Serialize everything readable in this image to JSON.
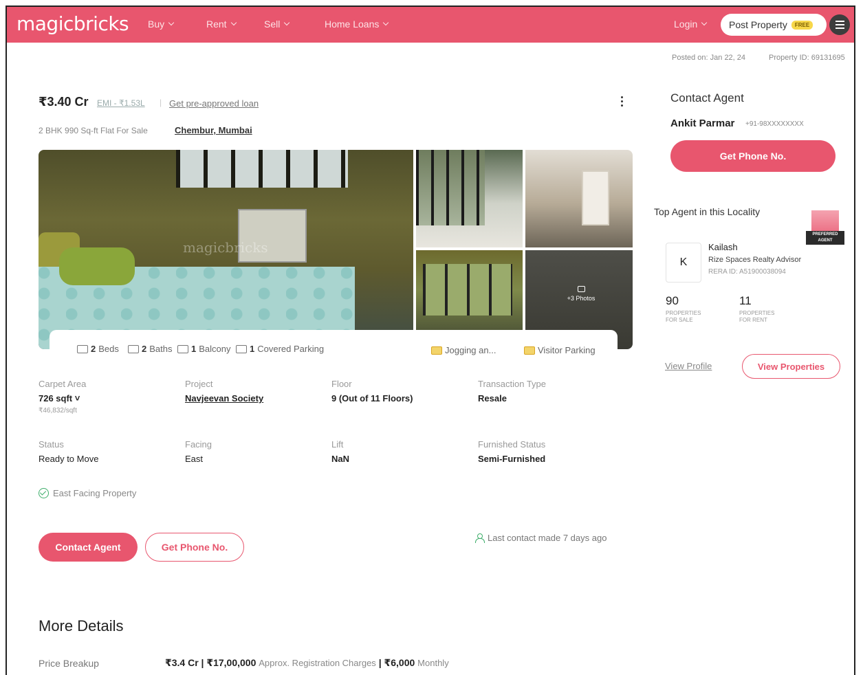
{
  "header": {
    "logo": "magicbricks",
    "nav": [
      {
        "label": "Buy"
      },
      {
        "label": "Rent"
      },
      {
        "label": "Sell"
      },
      {
        "label": "Home Loans"
      }
    ],
    "login_label": "Login",
    "post_property_label": "Post Property",
    "free_badge": "FREE",
    "brand_color": "#e8566e"
  },
  "meta": {
    "posted_on": "Posted on: Jan 22, 24",
    "property_id": "Property ID: 69131695"
  },
  "listing": {
    "price": "₹3.40 Cr",
    "emi": "EMI - ₹1.53L",
    "separator": "|",
    "loan_link": "Get pre-approved loan",
    "subtitle": "2 BHK 990 Sq-ft Flat For Sale",
    "locality": "Chembur, Mumbai",
    "watermark": "magicbricks",
    "more_photos": "+3 Photos"
  },
  "amenities": {
    "beds": "2",
    "beds_label": "Beds",
    "baths": "2",
    "baths_label": "Baths",
    "balcony": "1",
    "balcony_label": "Balcony",
    "parking": "1",
    "parking_label": "Covered Parking",
    "jogging": "Jogging an...",
    "visitor_parking": "Visitor Parking"
  },
  "details": [
    {
      "label": "Carpet Area",
      "value": "726 sqft ˅",
      "sub": "₹46,832/sqft"
    },
    {
      "label": "Project",
      "value": "Navjeevan Society"
    },
    {
      "label": "Floor",
      "value": "9 (Out of 11 Floors)"
    },
    {
      "label": "Transaction Type",
      "value": "Resale"
    },
    {
      "label": "Status",
      "value": "Ready to Move"
    },
    {
      "label": "Facing",
      "value": "East"
    },
    {
      "label": "Lift",
      "value": "NaN"
    },
    {
      "label": "Furnished Status",
      "value": "Semi-Furnished"
    }
  ],
  "highlight": "East Facing Property",
  "actions": {
    "contact_agent": "Contact Agent",
    "get_phone": "Get Phone No.",
    "last_contact": "Last contact made 7 days ago"
  },
  "more_details": {
    "title": "More Details",
    "price_breakup_label": "Price Breakup",
    "price_main": "₹3.4 Cr | ₹17,00,000",
    "price_reg": "Approx. Registration Charges",
    "price_sep": "| ₹6,000",
    "price_monthly": "Monthly"
  },
  "sidebar": {
    "contact_title": "Contact Agent",
    "agent_name": "Ankit Parmar",
    "agent_phone": "+91-98XXXXXXXX",
    "phone_btn": "Get Phone No.",
    "top_agent_title": "Top Agent in this Locality",
    "badge_text": "PREFERRED AGENT",
    "avatar_initial": "K",
    "top_agent_name": "Kailash",
    "top_agent_org": "Rize Spaces Realty Advisor",
    "top_agent_rera": "RERA ID: A51900038094",
    "props_sale": "90",
    "props_sale_cap": "Properties for sale",
    "props_rent": "11",
    "props_rent_cap": "Properties for rent",
    "view_profile": "View Profile",
    "view_properties": "View Properties"
  }
}
